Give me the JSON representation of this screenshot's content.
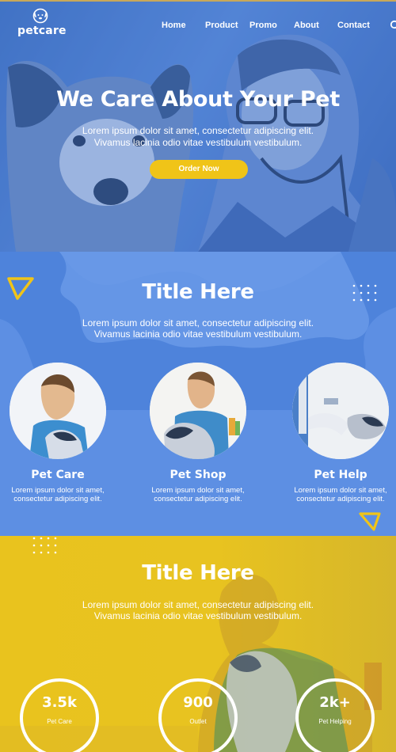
{
  "brand": {
    "name": "petcare",
    "logo_icon": "dog-head-icon"
  },
  "nav": {
    "items": [
      "Home",
      "Product",
      "Promo",
      "About",
      "Contact"
    ],
    "search_icon": "search-icon"
  },
  "hero": {
    "title": "We Care About Your Pet",
    "text": "Lorem ipsum dolor sit amet, consectetur adipiscing elit. Vivamus lacinia odio vitae vestibulum vestibulum.",
    "button": "Order Now"
  },
  "services": {
    "title": "Title Here",
    "text": "Lorem ipsum dolor sit amet, consectetur adipiscing elit. Vivamus lacinia odio vitae vestibulum vestibulum.",
    "cards": [
      {
        "title": "Pet Care",
        "text": "Lorem ipsum dolor sit amet, consectetur adipiscing elit."
      },
      {
        "title": "Pet Shop",
        "text": "Lorem ipsum dolor sit amet, consectetur adipiscing elit."
      },
      {
        "title": "Pet Help",
        "text": "Lorem ipsum dolor sit amet, consectetur adipiscing elit."
      }
    ]
  },
  "stats": {
    "title": "Title Here",
    "text": "Lorem ipsum dolor sit amet, consectetur adipiscing elit. Vivamus lacinia odio vitae vestibulum vestibulum.",
    "items": [
      {
        "value": "3.5k",
        "label": "Pet Care"
      },
      {
        "value": "900",
        "label": "Outlet"
      },
      {
        "value": "2k+",
        "label": "Pet Helping"
      }
    ]
  },
  "colors": {
    "blue": "#5d8fe3",
    "blue_dark": "#4a7fd8",
    "yellow": "#f0c418",
    "white": "#ffffff"
  }
}
